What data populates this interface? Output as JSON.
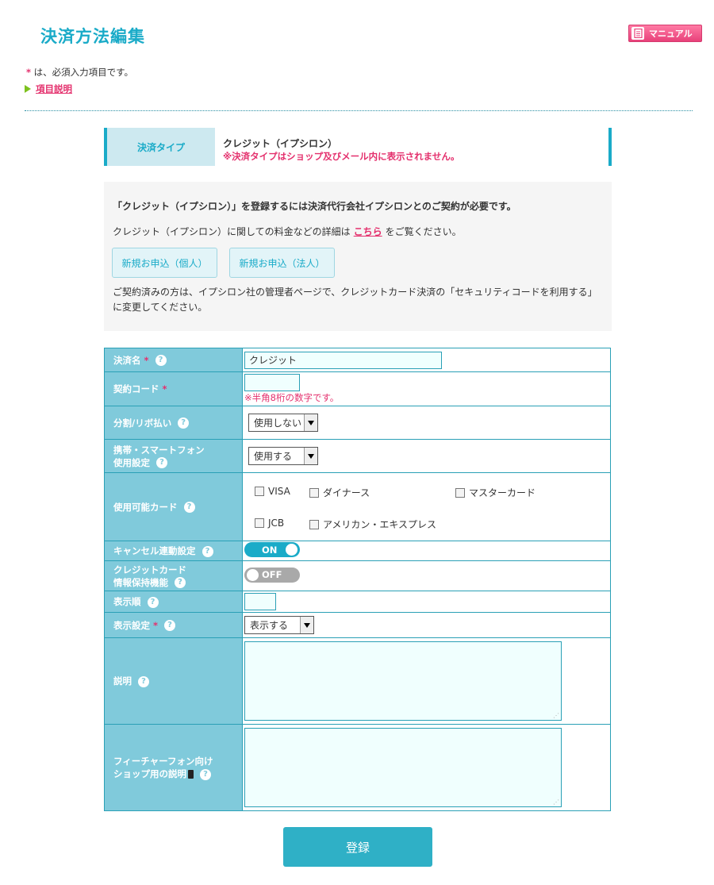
{
  "header": {
    "title": "決済方法編集",
    "manual_label": "マニュアル"
  },
  "notes": {
    "required_mark": "*",
    "required_text": " は、必須入力項目です。",
    "help_link": "項目説明"
  },
  "payment_type": {
    "label": "決済タイプ",
    "value": "クレジット（イプシロン）",
    "note": "※決済タイプはショップ及びメール内に表示されません。"
  },
  "info": {
    "line1": "「クレジット（イプシロン）」を登録するには決済代行会社イプシロンとのご契約が必要です。",
    "line2_before": "クレジット（イプシロン）に関しての料金などの詳細は",
    "line2_link": "こちら",
    "line2_after": "をご覧ください。",
    "apply_personal": "新規お申込（個人）",
    "apply_corporate": "新規お申込（法人）",
    "line3": "ご契約済みの方は、イプシロン社の管理者ページで、クレジットカード決済の「セキュリティコードを利用する」に変更してください。"
  },
  "form": {
    "help_mark": "?",
    "required_mark": "*",
    "payment_name": {
      "label": "決済名",
      "value": "クレジット"
    },
    "contract_code": {
      "label": "契約コード",
      "value": "",
      "note": "※半角8桁の数字です。"
    },
    "installment": {
      "label": "分割/リボ払い",
      "selected": "使用しない"
    },
    "mobile": {
      "label_line1": "携帯・スマートフォン",
      "label_line2": "使用設定",
      "selected": "使用する"
    },
    "cards": {
      "label": "使用可能カード",
      "visa": "VISA",
      "diners": "ダイナース",
      "master": "マスターカード",
      "jcb": "JCB",
      "amex": "アメリカン・エキスプレス"
    },
    "cancel_link": {
      "label": "キャンセル連動設定",
      "state": "ON"
    },
    "card_keep": {
      "label_line1": "クレジットカード",
      "label_line2": "情報保持機能",
      "state": "OFF"
    },
    "display_order": {
      "label": "表示順",
      "value": ""
    },
    "display_setting": {
      "label": "表示設定",
      "selected": "表示する"
    },
    "description": {
      "label": "説明"
    },
    "feature_phone": {
      "label_line1": "フィーチャーフォン向け",
      "label_line2": "ショップ用の説明"
    }
  },
  "submit_label": "登録"
}
